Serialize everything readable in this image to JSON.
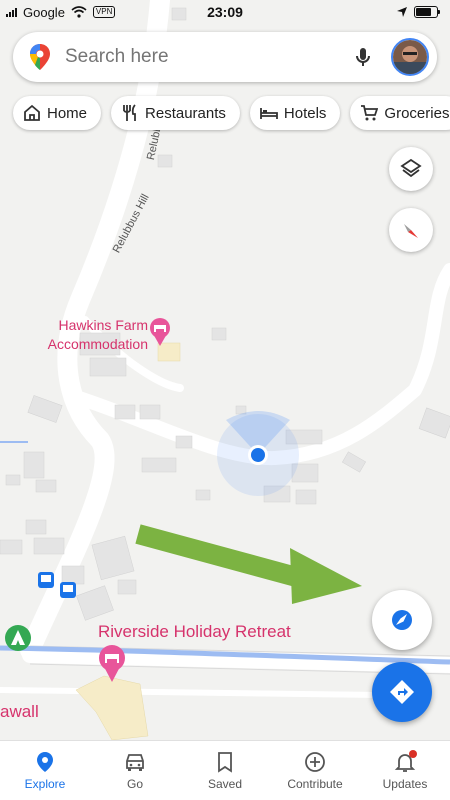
{
  "status_bar": {
    "carrier": "Google",
    "vpn": "VPN",
    "time": "23:09"
  },
  "search": {
    "placeholder": "Search here"
  },
  "chips": [
    {
      "label": "Home",
      "icon": "home-icon"
    },
    {
      "label": "Restaurants",
      "icon": "fork-knife-icon"
    },
    {
      "label": "Hotels",
      "icon": "bed-icon"
    },
    {
      "label": "Groceries",
      "icon": "cart-icon"
    }
  ],
  "map": {
    "labels": {
      "road_1": "Relubbus Hill",
      "road_2": "Relubbus Hill",
      "poi_hawkins": "Hawkins Farm\nAccommodation",
      "poi_riverside": "Riverside Holiday Retreat",
      "place_partial": "awall"
    }
  },
  "controls": {
    "layers_icon": "layers-icon",
    "compass_icon": "compass-icon",
    "location_icon": "my-location-icon",
    "directions_icon": "directions-icon"
  },
  "colors": {
    "accent": "#1a73e8",
    "poi": "#d6336c",
    "river": "#9dbcf2",
    "arrow": "#7cb342"
  },
  "bottom_nav": [
    {
      "label": "Explore",
      "icon": "explore-pin-icon",
      "active": true
    },
    {
      "label": "Go",
      "icon": "car-icon",
      "active": false
    },
    {
      "label": "Saved",
      "icon": "bookmark-icon",
      "active": false
    },
    {
      "label": "Contribute",
      "icon": "plus-circle-icon",
      "active": false
    },
    {
      "label": "Updates",
      "icon": "bell-icon",
      "active": false
    }
  ]
}
